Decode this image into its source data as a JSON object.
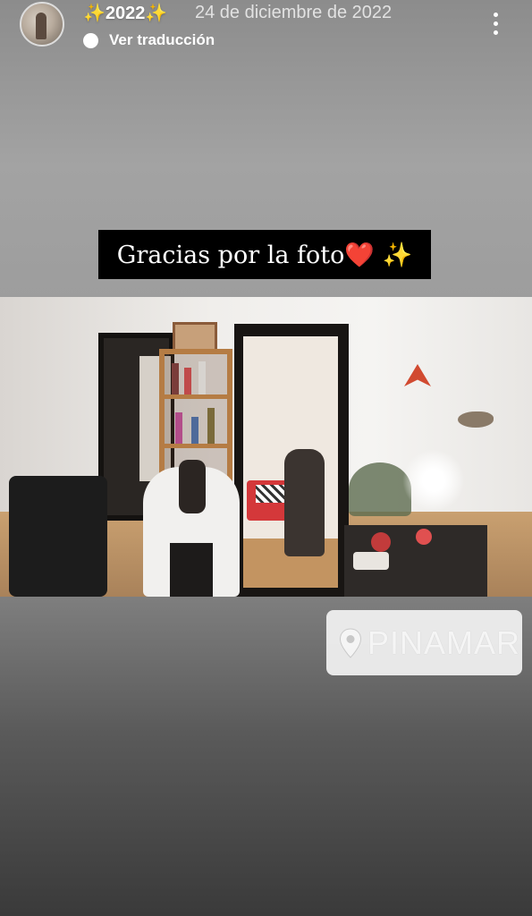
{
  "header": {
    "username": "✨2022✨",
    "date": "24 de diciembre de 2022",
    "translate_label": "Ver traducción",
    "avatar_icon": "avatar",
    "translate_icon": "speech-bubble-icon",
    "more_icon": "more-vertical-icon"
  },
  "caption": {
    "text": "Gracias por la foto❤️ ✨"
  },
  "location": {
    "name": "PINAMAR",
    "icon": "location-pin-icon"
  },
  "colors": {
    "caption_bg": "#000000",
    "sticker_bg": "#f2f2f2",
    "text": "#ffffff"
  }
}
